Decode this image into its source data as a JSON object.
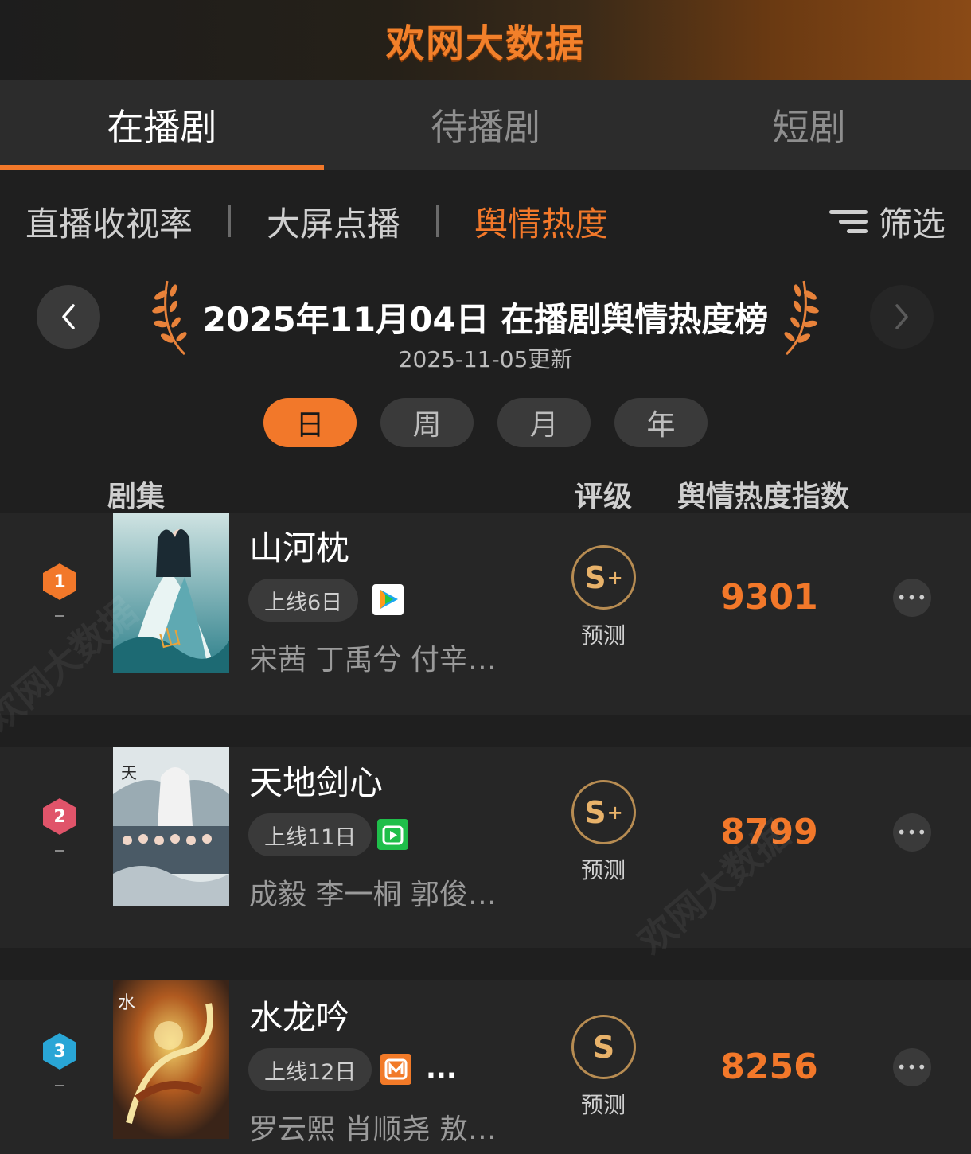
{
  "banner": {
    "logo_text": "欢网大数据"
  },
  "main_tabs": [
    {
      "label": "在播剧",
      "active": true
    },
    {
      "label": "待播剧",
      "active": false
    },
    {
      "label": "短剧",
      "active": false
    }
  ],
  "sub_tabs": [
    {
      "label": "直播收视率",
      "active": false
    },
    {
      "label": "大屏点播",
      "active": false
    },
    {
      "label": "舆情热度",
      "active": true
    }
  ],
  "filter_label": "筛选",
  "ranking": {
    "title": "2025年11月04日 在播剧舆情热度榜",
    "updated": "2025-11-05更新",
    "prev_icon": "chevron-left-icon",
    "next_icon": "chevron-right-icon"
  },
  "periods": [
    {
      "label": "日",
      "active": true
    },
    {
      "label": "周",
      "active": false
    },
    {
      "label": "月",
      "active": false
    },
    {
      "label": "年",
      "active": false
    }
  ],
  "columns": {
    "show": "剧集",
    "grade": "评级",
    "index": "舆情热度指数"
  },
  "rows": [
    {
      "rank": "1",
      "rank_color": "#f2782a",
      "title": "山河枕",
      "days": "上线6日",
      "platform": "tencent-video-icon",
      "cast": "宋茜 丁禹兮 付辛…",
      "grade": "S",
      "grade_plus": "+",
      "grade_label": "预测",
      "score": "9301"
    },
    {
      "rank": "2",
      "rank_color": "#e0546a",
      "title": "天地剑心",
      "days": "上线11日",
      "platform": "iqiyi-icon",
      "cast": "成毅 李一桐 郭俊…",
      "grade": "S",
      "grade_plus": "+",
      "grade_label": "预测",
      "score": "8799"
    },
    {
      "rank": "3",
      "rank_color": "#29a6d6",
      "title": "水龙吟",
      "days": "上线12日",
      "platform": "mango-tv-icon",
      "extra": "...",
      "cast": "罗云熙 肖顺尧 敖…",
      "grade": "S",
      "grade_plus": "",
      "grade_label": "预测",
      "score": "8256"
    }
  ],
  "colors": {
    "accent": "#f2782a",
    "background": "#1f1f1f",
    "row_bg": "#262626"
  }
}
